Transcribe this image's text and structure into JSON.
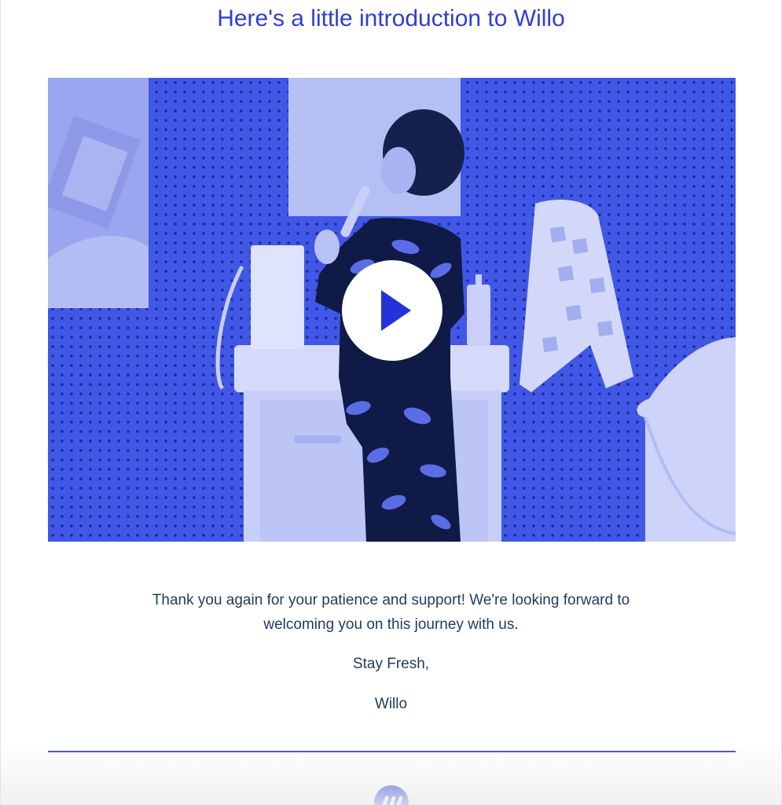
{
  "email": {
    "title": "Here's a little introduction to Willo",
    "video": {
      "play_icon": "play-icon",
      "colors": {
        "background": "#4157e6",
        "play_triangle": "#2433d9"
      }
    },
    "message": "Thank you again for your patience and support! We're looking forward to welcoming you on this journey with us.",
    "signoff": "Stay Fresh,",
    "signature": "Willo",
    "footer": {
      "logo_icon": "willo-logo-icon"
    },
    "accent_color": "#2e3ed6"
  }
}
